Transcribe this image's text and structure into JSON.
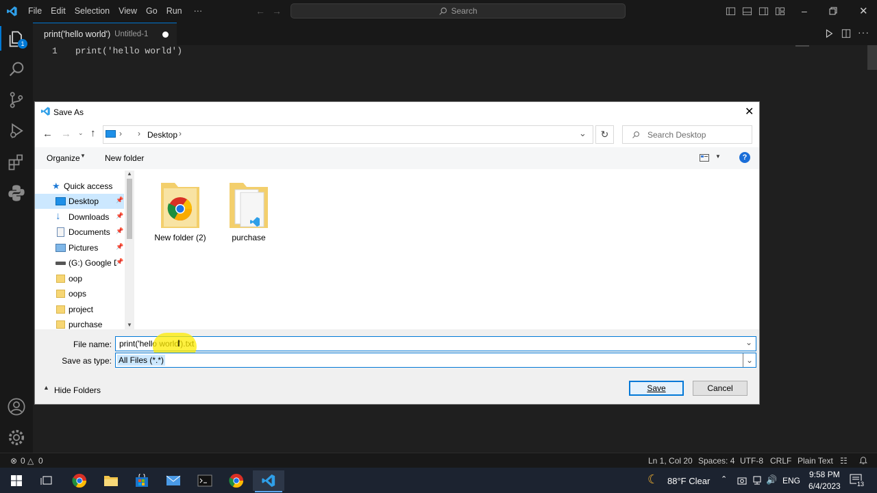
{
  "titlebar": {
    "menus": [
      "File",
      "Edit",
      "Selection",
      "View",
      "Go",
      "Run",
      "···"
    ],
    "search_placeholder": "Search"
  },
  "activitybar": {
    "explorer_badge": "1"
  },
  "editor": {
    "tab_name": "print('hello world')",
    "tab_file": "Untitled-1",
    "lines": [
      {
        "number": "1",
        "text": "print('hello world')"
      }
    ]
  },
  "dialog": {
    "title": "Save As",
    "address": "Desktop",
    "search_placeholder": "Search Desktop",
    "organize_label": "Organize",
    "new_folder_label": "New folder",
    "nav": [
      {
        "label": "Quick access"
      },
      {
        "label": "Desktop"
      },
      {
        "label": "Downloads"
      },
      {
        "label": "Documents"
      },
      {
        "label": "Pictures"
      },
      {
        "label": "(G:) Google D"
      },
      {
        "label": "oop"
      },
      {
        "label": "oops"
      },
      {
        "label": "project"
      },
      {
        "label": "purchase"
      }
    ],
    "files": [
      {
        "name": "New folder (2)"
      },
      {
        "name": "purchase"
      }
    ],
    "file_name_label": "File name:",
    "file_name_value": "print('hello world').txt",
    "save_type_label": "Save as type:",
    "save_type_value": "All Files (*.*)",
    "hide_folders_label": "Hide Folders",
    "save_label": "Save",
    "cancel_label": "Cancel"
  },
  "statusbar": {
    "errors": "0",
    "warnings": "0",
    "position": "Ln 1, Col 20",
    "spaces": "Spaces: 4",
    "encoding": "UTF-8",
    "eol": "CRLF",
    "language": "Plain Text"
  },
  "taskbar": {
    "weather": "88°F  Clear",
    "language": "ENG",
    "time": "9:58 PM",
    "date": "6/4/2023",
    "notifications": "13"
  },
  "colors": {
    "accent": "#0078d4",
    "dialog_save_border": "#0078d7"
  }
}
